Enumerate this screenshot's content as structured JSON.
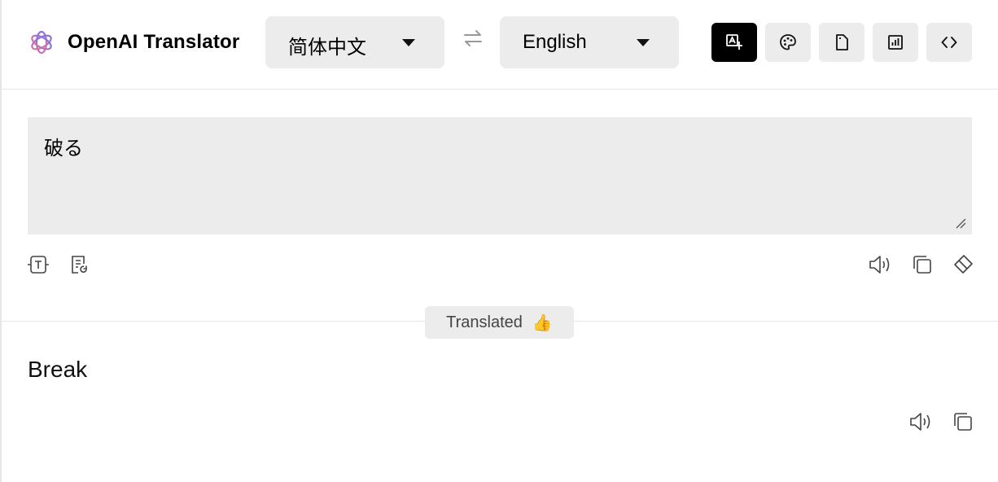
{
  "header": {
    "title": "OpenAI Translator",
    "source_lang": "简体中文",
    "target_lang": "English",
    "accent": "#000000"
  },
  "icons": {
    "logo": "openai-logo",
    "swap": "swap-arrows-icon",
    "toolbar": [
      "translate-icon",
      "palette-icon",
      "file-icon",
      "chart-icon",
      "code-icon"
    ],
    "input_tools_left": [
      "text-format-icon",
      "document-refresh-icon"
    ],
    "input_tools_right": [
      "speaker-icon",
      "copy-icon",
      "eraser-icon"
    ],
    "output_tools": [
      "speaker-icon",
      "copy-icon"
    ]
  },
  "input": {
    "value": "破る"
  },
  "status": {
    "label": "Translated",
    "emoji": "👍"
  },
  "output": {
    "text": "Break"
  }
}
